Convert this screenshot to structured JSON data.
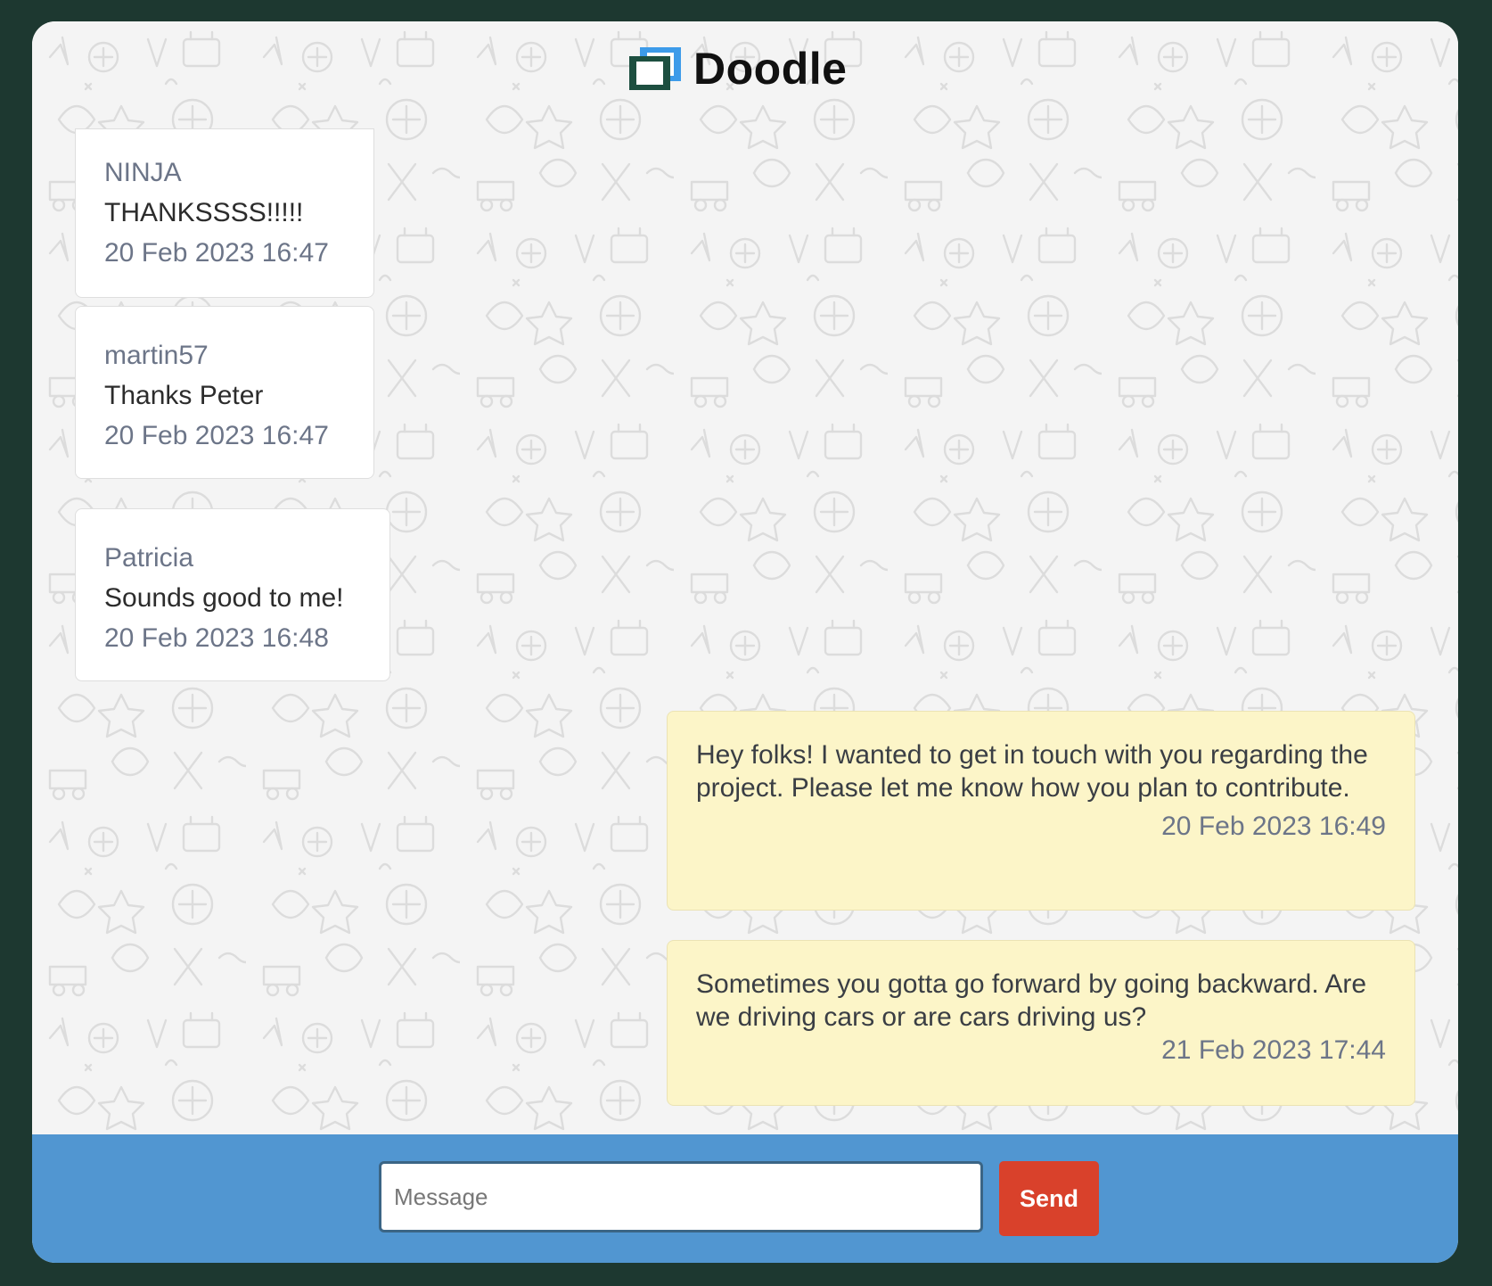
{
  "app": {
    "name": "Doodle"
  },
  "colors": {
    "window_background": "#1d3830",
    "chat_background": "#f4f4f4",
    "composer_bar": "#5196d1",
    "send_button": "#d9412b",
    "incoming_bubble": "#ffffff",
    "outgoing_bubble": "#fcf5c8",
    "logo_blue": "#3d9be9",
    "logo_green": "#1d4f40"
  },
  "messages": [
    {
      "direction": "incoming",
      "author": "NINJA",
      "text": "THANKSSSS!!!!!",
      "time": "20 Feb 2023 16:47"
    },
    {
      "direction": "incoming",
      "author": "martin57",
      "text": "Thanks Peter",
      "time": "20 Feb 2023 16:47"
    },
    {
      "direction": "incoming",
      "author": "Patricia",
      "text": "Sounds good to me!",
      "time": "20 Feb 2023 16:48"
    },
    {
      "direction": "outgoing",
      "text": "Hey folks! I wanted to get in touch with you regarding the project. Please let me know how you plan to contribute.",
      "time": "20 Feb 2023 16:49"
    },
    {
      "direction": "outgoing",
      "text": "Sometimes you gotta go forward by going backward. Are we driving cars or are cars driving us?",
      "time": "21 Feb 2023 17:44"
    }
  ],
  "composer": {
    "placeholder": "Message",
    "value": "",
    "send_label": "Send"
  },
  "icons": {
    "logo": "doodle-logo-icon",
    "background": "doodle-pattern"
  }
}
